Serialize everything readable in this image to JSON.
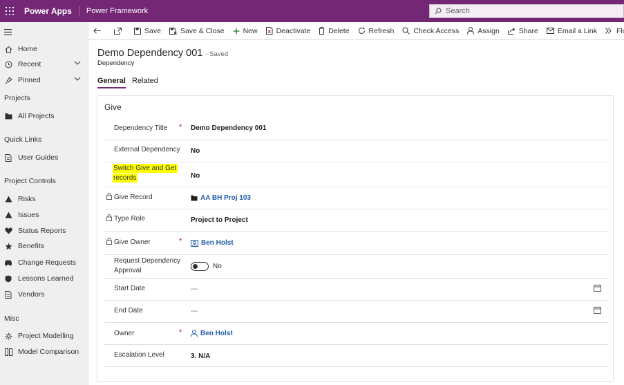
{
  "topbar": {
    "app_name": "Power Apps",
    "environment": "Power Framework",
    "search_placeholder": "Search",
    "color": "#742774"
  },
  "sidebar": {
    "items_top": [
      {
        "label": "Home",
        "icon": "home-icon"
      },
      {
        "label": "Recent",
        "icon": "clock-icon"
      },
      {
        "label": "Pinned",
        "icon": "pin-icon"
      }
    ],
    "projects_header": "Projects",
    "projects_items": [
      {
        "label": "All Projects",
        "icon": "folder-icon"
      }
    ],
    "quick_links_header": "Quick Links",
    "quick_links_items": [
      {
        "label": "User Guides",
        "icon": "document-icon"
      }
    ],
    "project_controls_header": "Project Controls",
    "project_controls_items": [
      {
        "label": "Risks",
        "icon": "warning-icon"
      },
      {
        "label": "Issues",
        "icon": "warning-icon"
      },
      {
        "label": "Status Reports",
        "icon": "heart-icon"
      },
      {
        "label": "Benefits",
        "icon": "star-icon"
      },
      {
        "label": "Change Requests",
        "icon": "car-icon"
      },
      {
        "label": "Lessons Learned",
        "icon": "shield-icon"
      },
      {
        "label": "Vendors",
        "icon": "document-icon"
      }
    ],
    "misc_header": "Misc",
    "misc_items": [
      {
        "label": "Project Modelling",
        "icon": "gear-icon"
      },
      {
        "label": "Model Comparison",
        "icon": "compare-icon"
      }
    ]
  },
  "commands": {
    "save": "Save",
    "save_close": "Save & Close",
    "new": "New",
    "deactivate": "Deactivate",
    "delete": "Delete",
    "refresh": "Refresh",
    "check_access": "Check Access",
    "assign": "Assign",
    "share": "Share",
    "email_link": "Email a Link",
    "flow": "Flow"
  },
  "record": {
    "title": "Demo Dependency 001",
    "status": "- Saved",
    "entity": "Dependency"
  },
  "tabs": {
    "general": "General",
    "related": "Related"
  },
  "section": {
    "title": "Give",
    "fields": {
      "dependency_title": {
        "label": "Dependency Title",
        "required": "*",
        "value": "Demo Dependency 001"
      },
      "external_dependency": {
        "label": "External Dependency",
        "value": "No"
      },
      "switch_give_get_line1": "Switch Give and Get",
      "switch_give_get_line2": "records",
      "switch_give_get_value": "No",
      "give_record": {
        "label": "Give Record",
        "value": "AA BH Proj 103"
      },
      "type_role": {
        "label": "Type Role",
        "value": "Project to Project"
      },
      "give_owner": {
        "label": "Give Owner",
        "required": "*",
        "value": "Ben Holst"
      },
      "request_approval_line1": "Request Dependency",
      "request_approval_line2": "Approval",
      "request_approval_value": "No",
      "start_date": {
        "label": "Start Date",
        "value": "---"
      },
      "end_date": {
        "label": "End Date",
        "value": "---"
      },
      "owner": {
        "label": "Owner",
        "required": "*",
        "value": "Ben Holst"
      },
      "escalation_level": {
        "label": "Escalation Level",
        "value": "3. N/A"
      }
    }
  },
  "colors": {
    "highlight": "#ffff00",
    "link": "#1e5ca8",
    "required": "#a4262c"
  }
}
